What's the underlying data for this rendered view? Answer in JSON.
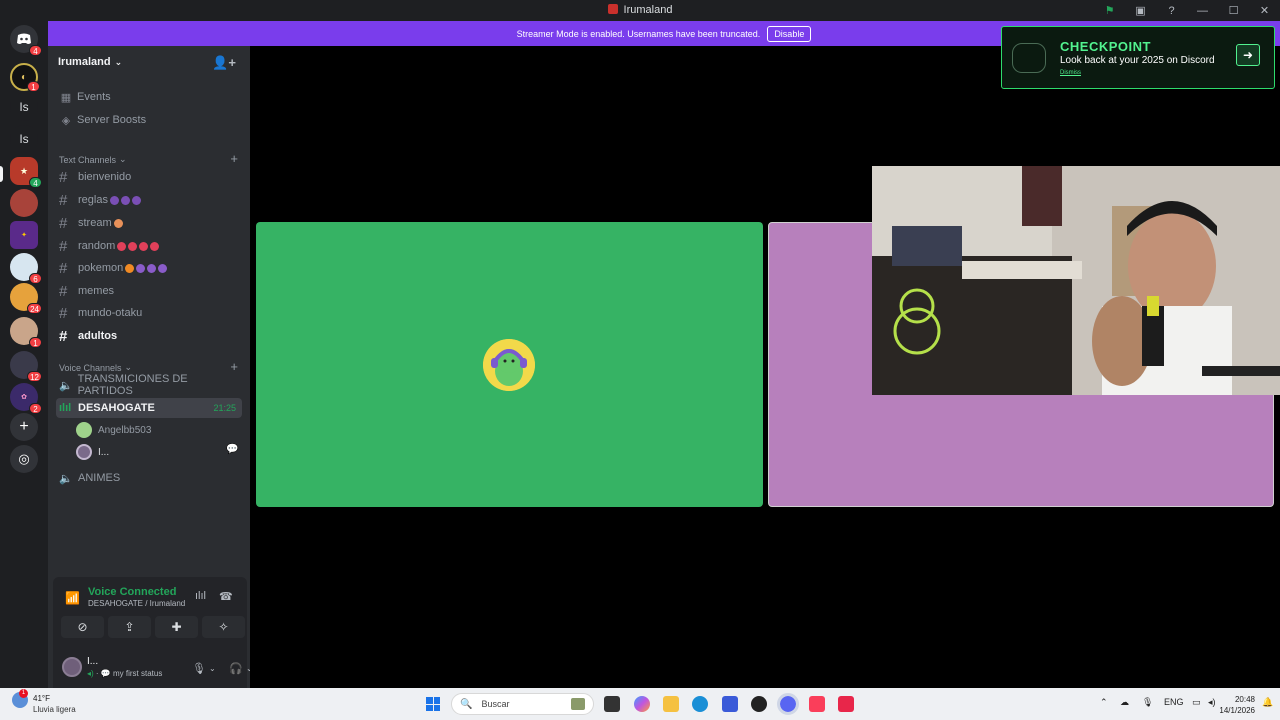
{
  "window": {
    "title": "Irumaland"
  },
  "banner": {
    "text": "Streamer Mode is enabled. Usernames have been truncated.",
    "disable_label": "Disable"
  },
  "server_rail": {
    "dm_badge": "4",
    "servers": [
      {
        "label": "",
        "badge": "1"
      },
      {
        "label": "Is",
        "badge": ""
      },
      {
        "label": "Is",
        "badge": ""
      },
      {
        "label": "",
        "badge": "4"
      },
      {
        "label": "",
        "badge": ""
      },
      {
        "label": "",
        "badge": ""
      },
      {
        "label": "",
        "badge": "6"
      },
      {
        "label": "",
        "badge": "24"
      },
      {
        "label": "",
        "badge": "1"
      },
      {
        "label": "",
        "badge": "12"
      },
      {
        "label": "",
        "badge": "2"
      }
    ]
  },
  "sidebar": {
    "server_name": "Irumaland",
    "nav": [
      {
        "label": "Events",
        "icon": "calendar-icon"
      },
      {
        "label": "Server Boosts",
        "icon": "boost-icon"
      }
    ],
    "text_category": "Text Channels",
    "text_channels": [
      "bienvenido",
      "reglas",
      "stream",
      "random",
      "pokemon",
      "memes",
      "mundo-otaku",
      "adultos"
    ],
    "voice_category": "Voice Channels",
    "voice_channels": [
      {
        "name": "TRANSMICIONES DE PARTIDOS"
      },
      {
        "name": "DESAHOGATE",
        "duration": "21:25"
      },
      {
        "name": "ANIMES"
      }
    ],
    "voice_users": [
      "Angelbb503",
      "I..."
    ]
  },
  "voice_panel": {
    "status": "Voice Connected",
    "channel": "DESAHOGATE / Irumaland"
  },
  "user_panel": {
    "name": "I...",
    "status": "my first status"
  },
  "checkpoint": {
    "title": "CHECKPOINT",
    "text": "Look back at your 2025 on Discord",
    "dismiss": "Dismiss"
  },
  "taskbar": {
    "temp": "41°F",
    "weather": "Lluvia ligera",
    "weather_badge": "1",
    "search_placeholder": "Buscar",
    "lang": "ENG",
    "time": "20:48",
    "date": "14/1/2026"
  },
  "colors": {
    "banner": "#7a3dec",
    "tile_green": "#36b364",
    "tile_pink": "#b780bc",
    "voice_connected": "#23a55a",
    "checkpoint_accent": "#52f28f"
  }
}
